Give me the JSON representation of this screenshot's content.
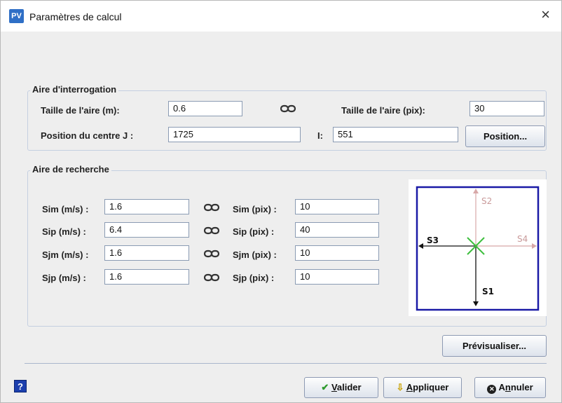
{
  "window": {
    "title": "Paramètres de calcul",
    "icon": "app-logo-icon",
    "icon_text": "PV",
    "close_glyph": "×"
  },
  "interrogation": {
    "legend": "Aire d'interrogation",
    "taille_m_label": "Taille de l'aire (m):",
    "taille_m_value": "0.6",
    "taille_pix_label": "Taille de l'aire (pix):",
    "taille_pix_value": "30",
    "position_label": "Position du centre  J :",
    "j_value": "1725",
    "i_label": "I:",
    "i_value": "551",
    "position_button": "Position..."
  },
  "recherche": {
    "legend": "Aire de recherche",
    "rows": [
      {
        "m_label": "Sim (m/s) :",
        "m_value": "1.6",
        "pix_label": "Sim (pix) :",
        "pix_value": "10"
      },
      {
        "m_label": "Sip (m/s) :",
        "m_value": "6.4",
        "pix_label": "Sip (pix) :",
        "pix_value": "40"
      },
      {
        "m_label": "Sjm (m/s) :",
        "m_value": "1.6",
        "pix_label": "Sjm (pix) :",
        "pix_value": "10"
      },
      {
        "m_label": "Sjp (m/s) :",
        "m_value": "1.6",
        "pix_label": "Sjp (pix) :",
        "pix_value": "10"
      }
    ],
    "diagram": {
      "s1": "S1",
      "s2": "S2",
      "s3": "S3",
      "s4": "S4"
    }
  },
  "buttons": {
    "previsualiser": "Prévisualiser...",
    "valider_acc": "V",
    "valider_rest": "alider",
    "appliquer_acc": "A",
    "appliquer_rest": "ppliquer",
    "annuler_pre": "A",
    "annuler_acc": "n",
    "annuler_rest": "nuler",
    "help": "?"
  },
  "colors": {
    "accent": "#1a1aa6",
    "check": "#2e9b2e",
    "cross": "#3fbf3f",
    "cancel": "#202020",
    "apply_arrow": "#c9a100"
  }
}
